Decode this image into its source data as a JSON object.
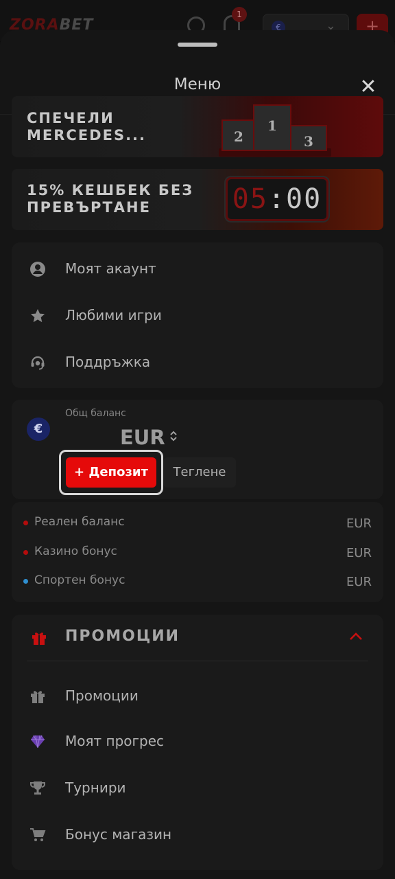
{
  "background_header": {
    "logo_part1": "ZORA",
    "logo_part2": "BET",
    "notification_count": "1",
    "currency_symbol": "€",
    "chevron": "⌄",
    "plus": "+"
  },
  "sheet": {
    "title": "Меню",
    "close_glyph": "✕"
  },
  "banners": [
    {
      "text": "СПЕЧЕЛИ\nMERCEDES...",
      "podium": [
        "2",
        "1",
        "3"
      ]
    },
    {
      "text": "15% КЕШБЕК БЕЗ\nПРЕВЪРТАНЕ",
      "clock_red": "05",
      "clock_white": ":00"
    }
  ],
  "account_menu": [
    {
      "label": "Моят акаунт",
      "icon": "user-circle-icon"
    },
    {
      "label": "Любими игри",
      "icon": "star-icon"
    },
    {
      "label": "Поддръжка",
      "icon": "headset-icon"
    }
  ],
  "balance": {
    "label": "Общ баланс",
    "currency_icon": "€",
    "value": "EUR",
    "switch_glyph": "⌃⌄",
    "deposit_label": "+ Депозит",
    "withdraw_label": "Теглене",
    "rows": [
      {
        "name": "Реален баланс",
        "currency": "EUR",
        "dot_color": "#b30c0c"
      },
      {
        "name": "Казино бонус",
        "currency": "EUR",
        "dot_color": "#b30c0c"
      },
      {
        "name": "Спортен бонус",
        "currency": "EUR",
        "dot_color": "#2f8fd0"
      }
    ]
  },
  "promotions": {
    "title": "ПРОМОЦИИ",
    "items": [
      {
        "label": "Промоции",
        "icon": "gift-icon"
      },
      {
        "label": "Моят прогрес",
        "icon": "diamond-icon"
      },
      {
        "label": "Турнири",
        "icon": "trophy-icon"
      },
      {
        "label": "Бонус магазин",
        "icon": "cart-icon"
      }
    ]
  },
  "colors": {
    "accent_red": "#e50a0a",
    "sheet_bg": "#151515",
    "card_bg": "#1a1a1a"
  }
}
